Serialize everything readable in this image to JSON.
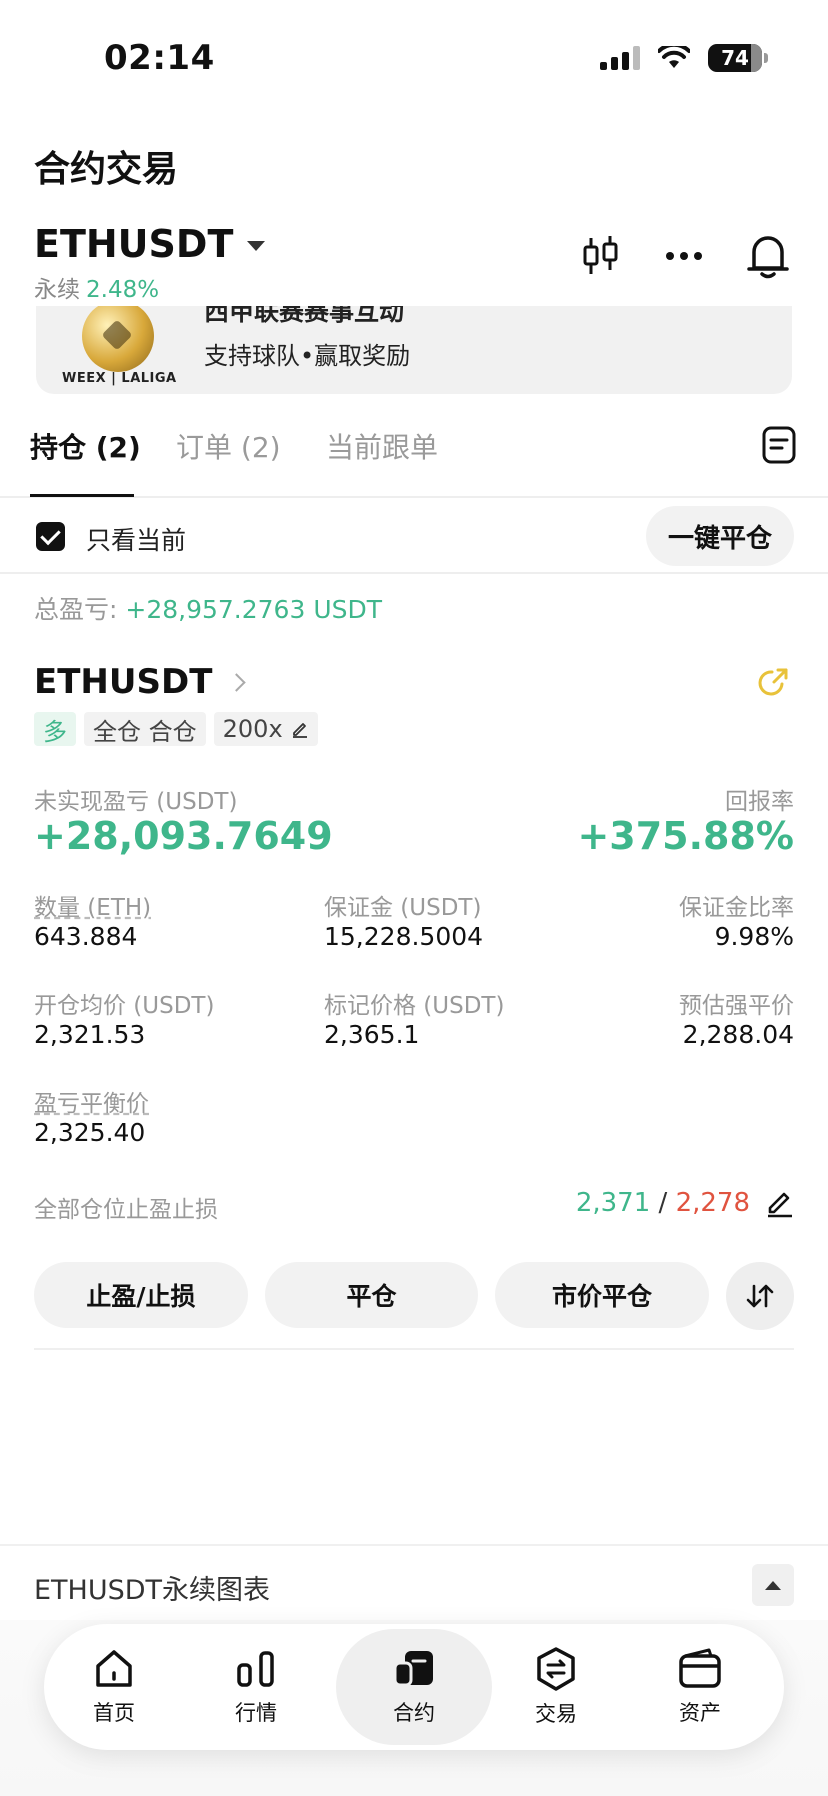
{
  "status_bar": {
    "time": "02:14",
    "battery": "74"
  },
  "page_title": "合约交易",
  "header": {
    "symbol": "ETHUSDT",
    "market_type": "永续",
    "change_pct": "2.48%"
  },
  "banner": {
    "title_partial": "西甲联赛赛事互动",
    "subtitle": "支持球队•赢取奖励",
    "logo_text": "WEEX | LALIGA"
  },
  "tabs": [
    {
      "label": "持仓 (2)",
      "active": true
    },
    {
      "label": "订单 (2)",
      "active": false
    },
    {
      "label": "当前跟单",
      "active": false
    }
  ],
  "filter": {
    "only_current_label": "只看当前",
    "only_current_checked": true,
    "close_all_label": "一键平仓"
  },
  "summary": {
    "total_pnl_label": "总盈亏: ",
    "total_pnl_value": "+28,957.2763 USDT"
  },
  "position": {
    "symbol": "ETHUSDT",
    "tags": {
      "side": "多",
      "margin_mode": "全仓 合仓",
      "leverage": "200x"
    },
    "unrealized_pnl_label": "未实现盈亏 (USDT)",
    "unrealized_pnl_value": "+28,093.7649",
    "roe_label": "回报率",
    "roe_value": "+375.88%",
    "fields": {
      "qty_label": "数量 (ETH)",
      "qty_value": "643.884",
      "margin_label": "保证金 (USDT)",
      "margin_value": "15,228.5004",
      "margin_ratio_label": "保证金比率",
      "margin_ratio_value": "9.98%",
      "entry_label": "开仓均价 (USDT)",
      "entry_value": "2,321.53",
      "mark_label": "标记价格 (USDT)",
      "mark_value": "2,365.1",
      "liq_label": "预估强平价",
      "liq_value": "2,288.04",
      "breakeven_label": "盈亏平衡价",
      "breakeven_value": "2,325.40"
    },
    "tpsl_label": "全部仓位止盈止损",
    "tp_value": "2,371",
    "separator": "/",
    "sl_value": "2,278",
    "buttons": {
      "tpsl": "止盈/止损",
      "close": "平仓",
      "market_close": "市价平仓"
    }
  },
  "chart_bar": {
    "label": "ETHUSDT永续图表"
  },
  "bottom_nav": [
    {
      "label": "首页",
      "icon": "home-icon"
    },
    {
      "label": "行情",
      "icon": "market-icon"
    },
    {
      "label": "合约",
      "icon": "futures-icon",
      "active": true
    },
    {
      "label": "交易",
      "icon": "trade-icon"
    },
    {
      "label": "资产",
      "icon": "wallet-icon"
    }
  ],
  "colors": {
    "green": "#3fb68b",
    "red": "#e0533f",
    "yellow": "#e8c23a"
  }
}
